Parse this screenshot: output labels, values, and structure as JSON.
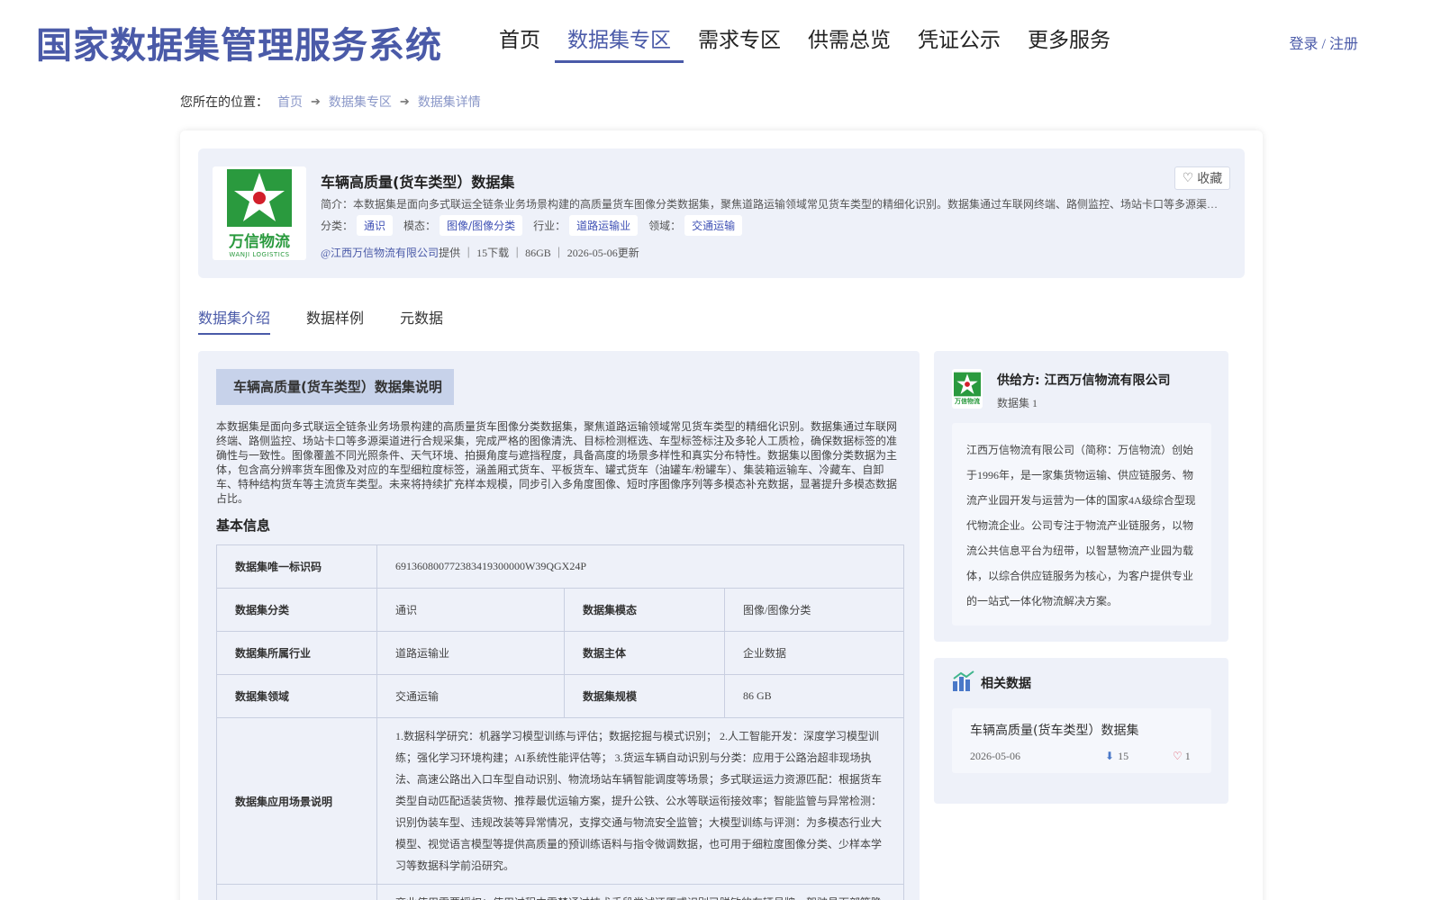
{
  "header": {
    "brand": "国家数据集管理服务系统",
    "nav": [
      "首页",
      "数据集专区",
      "需求专区",
      "供需总览",
      "凭证公示",
      "更多服务"
    ],
    "active_nav": "数据集专区",
    "login": "登录 / 注册"
  },
  "breadcrumb": {
    "prefix": "您所在的位置：",
    "items": [
      "首页",
      "数据集专区",
      "数据集详情"
    ]
  },
  "dataset": {
    "logo_text": "万信物流",
    "logo_subtext": "WANJI LOGISTICS",
    "title": "车辆高质量(货车类型）数据集",
    "intro": "简介：本数据集是面向多式联运全链条业务场景构建的高质量货车图像分类数据集，聚焦道路运输领域常见货车类型的精细化识别。数据集通过车联网终端、路侧监控、场站卡口等多源渠道进行合规采集，完成严格的图像清洗、目标检测框选、车型标签标注及多轮人工质检。",
    "favorite_label": "收藏",
    "tags": [
      {
        "label": "分类：",
        "value": "通识"
      },
      {
        "label": "模态：",
        "value": "图像/图像分类"
      },
      {
        "label": "行业：",
        "value": "道路运输业"
      },
      {
        "label": "领域：",
        "value": "交通运输"
      }
    ],
    "provider_link": "@江西万信物流有限公司",
    "meta_rest": "提供 ｜ 15下载 ｜ 86GB ｜ 2026-05-06更新"
  },
  "tabs": [
    "数据集介绍",
    "数据样例",
    "元数据"
  ],
  "active_tab": "数据集介绍",
  "detail": {
    "banner": "车辆高质量(货车类型）数据集说明",
    "description": "本数据集是面向多式联运全链条业务场景构建的高质量货车图像分类数据集，聚焦道路运输领域常见货车类型的精细化识别。数据集通过车联网终端、路侧监控、场站卡口等多源渠道进行合规采集，完成严格的图像清洗、目标检测框选、车型标签标注及多轮人工质检，确保数据标签的准确性与一致性。图像覆盖不同光照条件、天气环境、拍摄角度与遮挡程度，具备高度的场景多样性和真实分布特性。数据集以图像分类数据为主体，包含高分辨率货车图像及对应的车型细粒度标签，涵盖厢式货车、平板货车、罐式货车（油罐车/粉罐车）、集装箱运输车、冷藏车、自卸车、特种结构货车等主流货车类型。未来将持续扩充样本规模，同步引入多角度图像、短时序图像序列等多模态补充数据，显著提升多模态数据占比。",
    "basic_title": "基本信息",
    "table": {
      "id_key": "数据集唯一标识码",
      "id_val": "691360800772383419300000W39QGX24P",
      "rows": [
        {
          "k1": "数据集分类",
          "v1": "通识",
          "k2": "数据集模态",
          "v2": "图像/图像分类"
        },
        {
          "k1": "数据集所属行业",
          "v1": "道路运输业",
          "k2": "数据主体",
          "v2": "企业数据"
        },
        {
          "k1": "数据集领域",
          "v1": "交通运输",
          "k2": "数据集规模",
          "v2": "86 GB"
        }
      ],
      "scene_key": "数据集应用场景说明",
      "scene_val": "1.数据科学研究：机器学习模型训练与评估；数据挖掘与模式识别； 2.人工智能开发：深度学习模型训练；强化学习环境构建；AI系统性能评估等； 3.货运车辆自动识别与分类：应用于公路治超非现场执法、高速公路出入口车型自动识别、物流场站车辆智能调度等场景；多式联运运力资源匹配：根据货车类型自动匹配适装货物、推荐最优运输方案，提升公铁、公水等联运衔接效率；智能监管与异常检测：识别伪装车型、违规改装等异常情况，支撑交通与物流安全监管；大模型训练与评测：为多模态行业大模型、视觉语言模型等提供高质量的预训练语料与指令微调数据，也可用于细粒度图像分类、少样本学习等数据科学前沿研究。",
      "last_row_val": "商业使用需要授权：使用过程中需禁通过技术手段尝试还原或识别已脱敏的车辆号牌、驾驶员面部等隐私信息"
    }
  },
  "provider": {
    "name": "供给方: 江西万信物流有限公司",
    "count": "数据集 1",
    "description": "江西万信物流有限公司（简称：万信物流）创始于1996年，是一家集货物运输、供应链服务、物流产业园开发与运营为一体的国家4A级综合型现代物流企业。公司专注于物流产业链服务，以物流公共信息平台为纽带，以智慧物流产业园为载体，以综合供应链服务为核心，为客户提供专业的一站式一体化物流解决方案。"
  },
  "related": {
    "title": "相关数据",
    "items": [
      {
        "name": "车辆高质量(货车类型）数据集",
        "date": "2026-05-06",
        "downloads": "15",
        "likes": "1"
      }
    ]
  },
  "colors": {
    "accent": "#4a5aa8",
    "panel": "#eef1f9",
    "logo_green": "#2a9a3e",
    "logo_red": "#d21f2a"
  }
}
